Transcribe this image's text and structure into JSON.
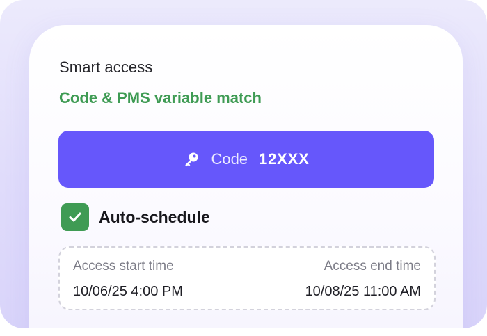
{
  "smart_access": {
    "title": "Smart access",
    "match_status": "Code & PMS variable match",
    "match_color": "#3f9b54"
  },
  "code_button": {
    "icon": "key-icon",
    "label": "Code",
    "value": "12XXX",
    "accent": "#6657fb"
  },
  "auto_schedule": {
    "checked": true,
    "icon": "check-icon",
    "label": "Auto-schedule"
  },
  "schedule": {
    "start_label": "Access start time",
    "start_value": "10/06/25 4:00 PM",
    "end_label": "Access end time",
    "end_value": "10/08/25 11:00 AM"
  }
}
